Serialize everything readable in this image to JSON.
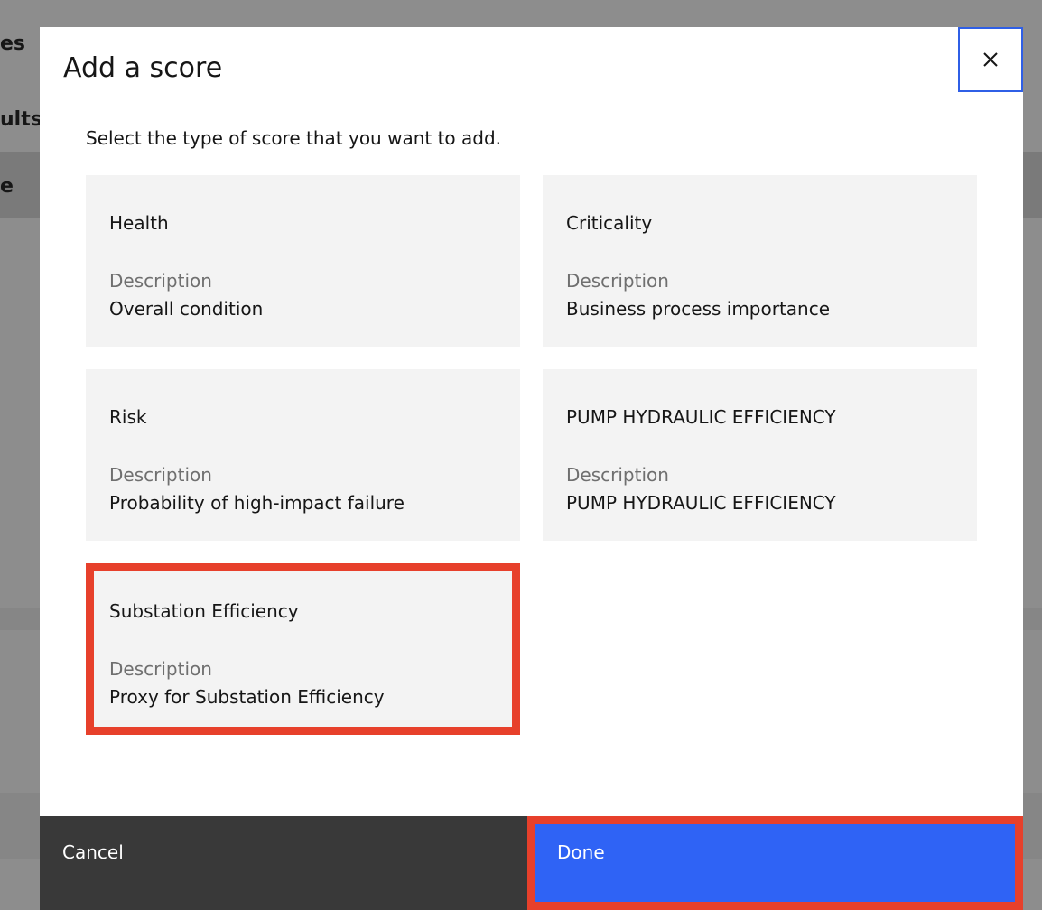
{
  "background": {
    "fragments": [
      "es",
      "ults:",
      "e"
    ]
  },
  "modal": {
    "title": "Add a score",
    "close_icon": "close-icon",
    "instructions": "Select the type of score that you want to add.",
    "tiles": [
      {
        "name": "Health",
        "desc_label": "Description",
        "desc": "Overall condition",
        "selected": false
      },
      {
        "name": "Criticality",
        "desc_label": "Description",
        "desc": "Business process importance",
        "selected": false
      },
      {
        "name": "Risk",
        "desc_label": "Description",
        "desc": "Probability of high-impact failure",
        "selected": false
      },
      {
        "name": "PUMP HYDRAULIC EFFICIENCY",
        "desc_label": "Description",
        "desc": "PUMP HYDRAULIC EFFICIENCY",
        "selected": false
      },
      {
        "name": "Substation Efficiency",
        "desc_label": "Description",
        "desc": "Proxy for Substation Efficiency",
        "selected": true
      }
    ],
    "footer": {
      "cancel_label": "Cancel",
      "done_label": "Done"
    }
  },
  "colors": {
    "primary": "#2f63f5",
    "secondary": "#393939",
    "highlight": "#e7402b",
    "focus": "#2f5fe6",
    "tile_bg": "#f3f3f3"
  }
}
